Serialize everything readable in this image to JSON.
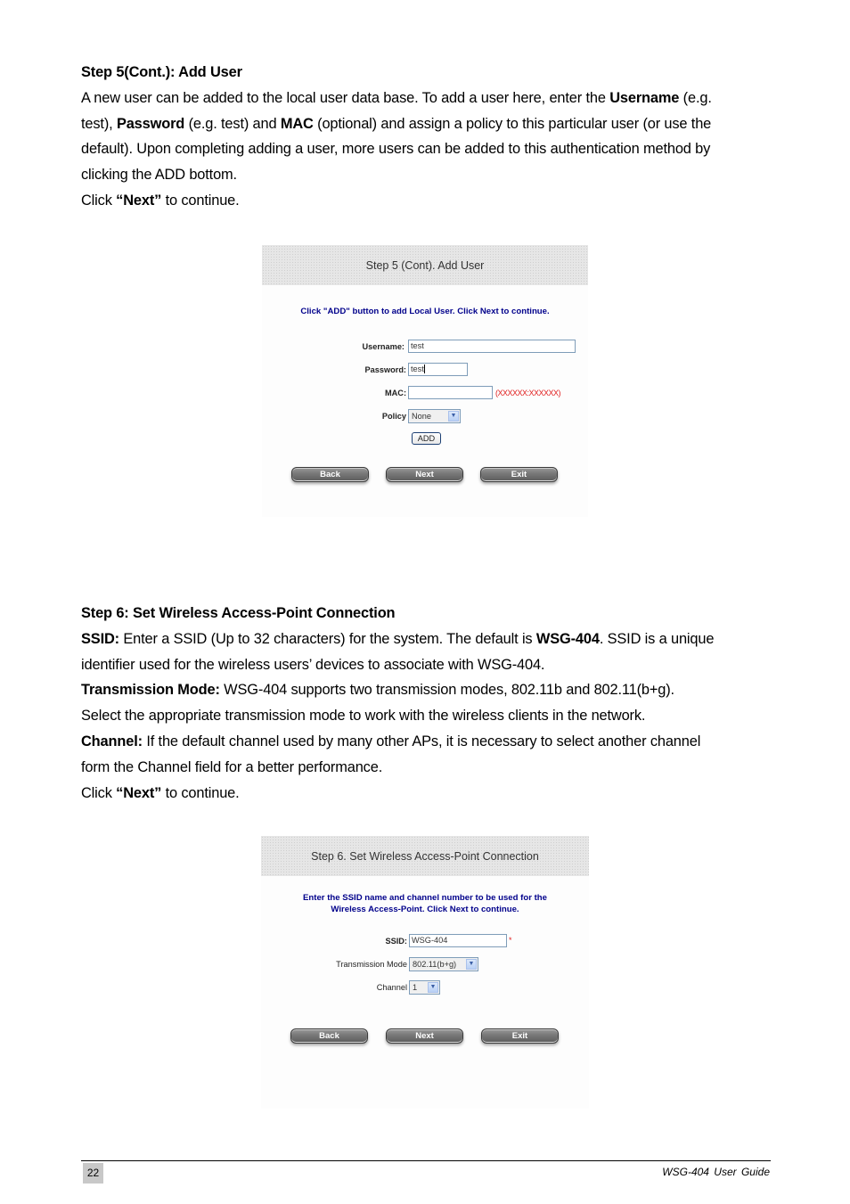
{
  "section1": {
    "heading": "Step 5(Cont.): Add User",
    "p1_a": "A new user can be added to the local user data base. To add a user here, enter the ",
    "p1_b_bold": "Username",
    "p1_c": " (e.g.",
    "p2_a": "test), ",
    "p2_b_bold": "Password",
    "p2_c": " (e.g. test) and ",
    "p2_d_bold": "MAC",
    "p2_e": " (optional) and assign a policy to this particular user (or use the",
    "p3": "default). Upon completing adding a user, more users can be added to this authentication method by",
    "p4": "clicking the ADD bottom.",
    "click_a": "Click ",
    "click_b_bold": "“Next”",
    "click_c": " to continue."
  },
  "screenshot1": {
    "title": "Step 5 (Cont). Add User",
    "intro": "Click \"ADD\" button to add Local User. Click Next to continue.",
    "username_label": "Username:",
    "username_value": "test",
    "password_label": "Password:",
    "password_value": "test",
    "mac_label": "MAC:",
    "mac_value": "",
    "mac_hint": "(XXXXXX:XXXXXX)",
    "policy_label": "Policy",
    "policy_value": "None",
    "add_button": "ADD",
    "back_button": "Back",
    "next_button": "Next",
    "exit_button": "Exit"
  },
  "section2": {
    "heading": "Step 6: Set Wireless Access-Point Connection",
    "ssid_bold": "SSID:",
    "ssid_a": " Enter a SSID (Up to 32 characters) for the system. The default is ",
    "ssid_b_bold": "WSG-404",
    "ssid_c": ". SSID is a unique",
    "ssid_line2": "identifier used for the wireless users’ devices to associate with WSG-404.",
    "tm_bold": "Transmission Mode:",
    "tm_a": " WSG-404 supports two transmission modes, 802.11b and 802.11(b+g).",
    "tm_line2": "Select the appropriate transmission mode to work with the wireless clients in the network.",
    "ch_bold": "Channel:",
    "ch_a": " If the default channel used by many other APs, it is necessary to select another channel",
    "ch_line2": "form the Channel field for a better performance.",
    "click_a": "Click ",
    "click_b_bold": "“Next”",
    "click_c": " to continue."
  },
  "screenshot2": {
    "title": "Step 6. Set Wireless Access-Point Connection",
    "intro_line1": "Enter the SSID name and channel number to be used for the",
    "intro_line2": "Wireless Access-Point. Click Next to continue.",
    "ssid_label": "SSID:",
    "ssid_value": "WSG-404",
    "required_mark": "*",
    "mode_label": "Transmission Mode",
    "mode_value": "802.11(b+g)",
    "channel_label": "Channel",
    "channel_value": "1",
    "back_button": "Back",
    "next_button": "Next",
    "exit_button": "Exit"
  },
  "footer": {
    "page_number": "22",
    "guide_title": "WSG-404  User  Guide"
  }
}
